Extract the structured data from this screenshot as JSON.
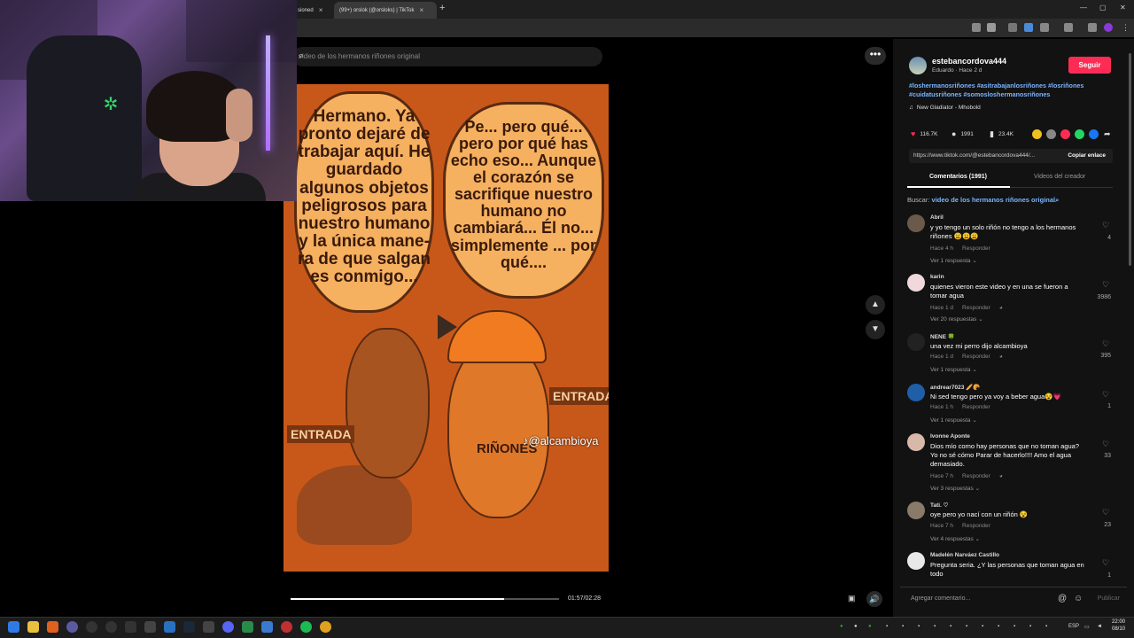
{
  "browser": {
    "tabs": [
      {
        "label": "sioned",
        "active": false
      },
      {
        "label": "(99+) orslok (@orsloks) | TikTok",
        "active": true
      }
    ],
    "window_controls": [
      "—",
      "▢",
      "✕"
    ]
  },
  "video_page": {
    "search_placeholder": "video de los hermanos riñones original",
    "more_label": "•••",
    "bubble_left": "Hermano. Ya pronto dejaré de trabajar aquí. He guardado algunos objetos peligrosos para nuestro humano y la única mane-ra de que salgan es conmigo...",
    "bubble_right": "Pe... pero qué... pero por qué has echo eso... Aunque el corazón se sacrifique nuestro humano no cambiará... Él no... simplemente ... por qué....",
    "sign_left": "ENTRADA",
    "sign_right": "ENTRADA",
    "kidney_label": "RIÑONES",
    "watermark": "♪@alcambioya",
    "progress_fraction": 0.796,
    "timecode": "01:57/02:28"
  },
  "panel": {
    "author": {
      "username": "estebancordova444",
      "subtitle": "Eduardo · Hace 2 d",
      "follow_label": "Seguir"
    },
    "hashtags": "#loshermanosriñones #asitrabajanlosriñones #losriñones #cuidatusriñones #somosloshermanosriñones",
    "music": "New Gladiator - Mhobold",
    "stats": {
      "likes": "116.7K",
      "comments": "1991",
      "saves": "23.4K"
    },
    "share_colors": [
      "#f0c020",
      "#888888",
      "#fe2c55",
      "#25d366",
      "#1877f2"
    ],
    "link": "https://www.tiktok.com/@estebancordova444/...",
    "copy_label": "Copiar enlace",
    "tabs": [
      "Comentarios (1991)",
      "Videos del creador"
    ],
    "search_prefix": "Buscar:",
    "search_term": "video de los hermanos riñones original",
    "comments": [
      {
        "name": "Abril",
        "text": "y yo tengo un solo riñón no tengo a los hermanos riñones 😩😩😩",
        "time": "Hace 4 h",
        "reply": "Responder",
        "more": "Ver 1 respuesta ⌄",
        "likes": "4",
        "avatar_color": "#6b5a4a"
      },
      {
        "name": "karin",
        "text": "quienes vieron este video y en una se fueron a tomar agua",
        "time": "Hace 1 d",
        "reply": "Responder",
        "more": "Ver 20 respuestas ⌄",
        "likes": "3986",
        "avatar_color": "#f0d8dc"
      },
      {
        "name": "NENE 🍀",
        "text": "una vez mi perro dijo alcambioya",
        "time": "Hace 1 d",
        "reply": "Responder",
        "more": "Ver 1 respuesta ⌄",
        "likes": "395",
        "avatar_color": "#222222"
      },
      {
        "name": "andrear7023 🥖🥐",
        "text": "Ni sed tengo pero ya voy a beber agua😵💗",
        "time": "Hace 1 h",
        "reply": "Responder",
        "more": "Ver 1 respuesta ⌄",
        "likes": "1",
        "avatar_color": "#1e5fa8"
      },
      {
        "name": "Ivonne Aponte",
        "text": "Dios mío como hay personas que no toman agua? Yo no sé cómo Parar de hacerlo!!!! Amo el agua demasiado.",
        "time": "Hace 7 h",
        "reply": "Responder",
        "more": "Ver 3 respuestas ⌄",
        "likes": "33",
        "avatar_color": "#d8b8a8"
      },
      {
        "name": "Tati. ♡",
        "text": "oye pero yo nací con un riñón 😵",
        "time": "Hace 7 h",
        "reply": "Responder",
        "more": "Ver 4 respuestas ⌄",
        "likes": "23",
        "avatar_color": "#8a7a6a"
      },
      {
        "name": "Madelén Narváez Castillo",
        "text": "Pregunta seria. ¿Y las personas que toman agua en todo",
        "time": "",
        "reply": "",
        "more": "",
        "likes": "1",
        "avatar_color": "#e8e8e8"
      }
    ],
    "add_comment_placeholder": "Agregar comentario...",
    "publish_label": "Publicar"
  },
  "taskbar": {
    "language": "ESP",
    "time": "22:00",
    "date": "08/10"
  }
}
